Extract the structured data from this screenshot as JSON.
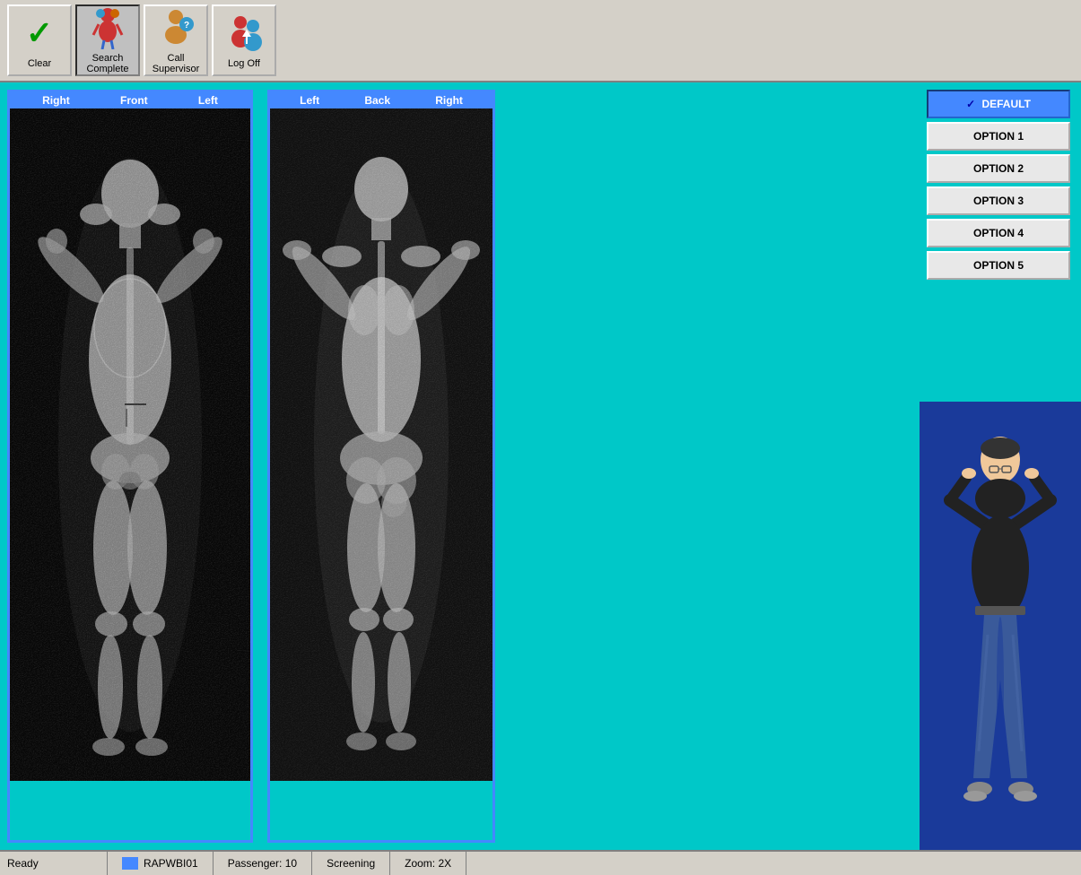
{
  "toolbar": {
    "buttons": [
      {
        "id": "clear",
        "label": "Clear",
        "icon": "check"
      },
      {
        "id": "search-complete",
        "label": "Search Complete",
        "icon": "search-complete"
      },
      {
        "id": "call-supervisor",
        "label": "Call Supervisor",
        "icon": "call-supervisor"
      },
      {
        "id": "log-off",
        "label": "Log Off",
        "icon": "log-off"
      }
    ]
  },
  "scan_panels": {
    "front_panel": {
      "headers": [
        "Right",
        "Front",
        "Left"
      ]
    },
    "back_panel": {
      "headers": [
        "Left",
        "Back",
        "Right"
      ]
    }
  },
  "options": {
    "items": [
      {
        "id": "default",
        "label": "DEFAULT",
        "selected": true
      },
      {
        "id": "option1",
        "label": "OPTION 1",
        "selected": false
      },
      {
        "id": "option2",
        "label": "OPTION 2",
        "selected": false
      },
      {
        "id": "option3",
        "label": "OPTION 3",
        "selected": false
      },
      {
        "id": "option4",
        "label": "OPTION 4",
        "selected": false
      },
      {
        "id": "option5",
        "label": "OPTION 5",
        "selected": false
      }
    ]
  },
  "statusbar": {
    "ready": "Ready",
    "station": "RAPWBI01",
    "passenger": "Passenger: 10",
    "screening": "Screening",
    "zoom": "Zoom: 2X"
  }
}
